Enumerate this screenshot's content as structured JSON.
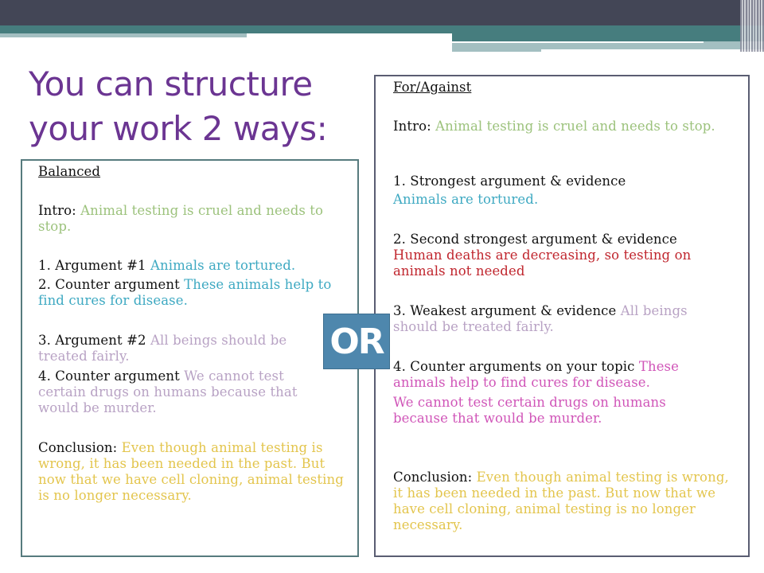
{
  "slide": {
    "title": "You can structure your work 2 ways:",
    "or_label": "OR",
    "colors": {
      "title": "#6b3592",
      "intro": "#9cc27c",
      "argument_blue": "#3ea9c2",
      "argument_lilac": "#b8a2c4",
      "conclusion": "#e3c54d",
      "argument_red": "#c0262e",
      "counter_pink": "#d055b8",
      "or_box": "#4e87ad"
    }
  },
  "balanced": {
    "heading": "Balanced",
    "intro_label": "Intro:",
    "intro_text": "Animal testing is cruel and needs to stop.",
    "items": [
      {
        "label": "1. Argument #1",
        "text": "Animals are tortured."
      },
      {
        "label": "2. Counter argument",
        "text": "These animals help to find cures for disease."
      },
      {
        "label": "3. Argument #2",
        "text": "All beings should be treated fairly."
      },
      {
        "label": "4. Counter argument",
        "text": "We cannot test certain drugs on humans because that would be murder."
      }
    ],
    "conclusion_label": "Conclusion:",
    "conclusion_text": "Even though animal testing is wrong, it has been needed in the past. But now that we have cell cloning, animal testing is no longer necessary."
  },
  "for_against": {
    "heading": "For/Against",
    "intro_label": "Intro:",
    "intro_text": "Animal testing is cruel and needs to stop.",
    "items": [
      {
        "label": "1. Strongest argument & evidence",
        "text": "Animals are tortured."
      },
      {
        "label": "2. Second strongest argument & evidence",
        "text": "Human deaths are decreasing, so testing on animals not needed"
      },
      {
        "label": "3. Weakest argument & evidence",
        "text": "All beings should be treated fairly."
      },
      {
        "label": "4. Counter arguments on your topic",
        "text": "These animals help to find cures for disease.",
        "text2": "We cannot test certain drugs on humans because that would be murder."
      }
    ],
    "conclusion_label": "Conclusion:",
    "conclusion_text": "Even though animal testing is wrong, it has been needed in the past. But now that we have cell cloning, animal testing is no longer necessary."
  }
}
